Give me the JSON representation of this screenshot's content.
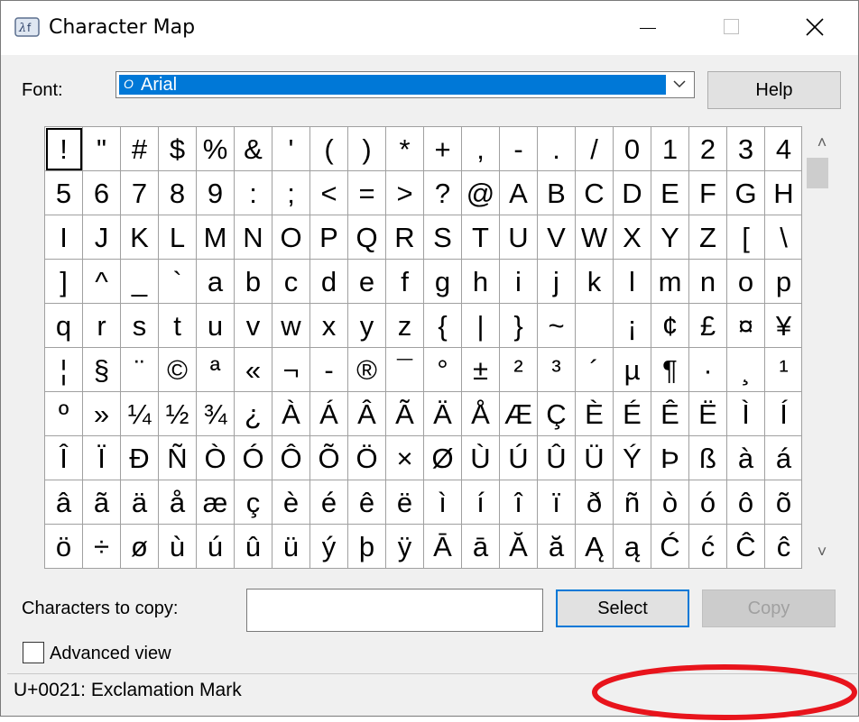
{
  "window": {
    "title": "Character Map",
    "app_icon": "charmap-icon"
  },
  "titlebar_buttons": {
    "minimize": "minimize-icon",
    "maximize": "maximize-icon",
    "close": "close-icon"
  },
  "font": {
    "label": "Font:",
    "value": "Arial",
    "glyph": "O"
  },
  "help_label": "Help",
  "characters": [
    "!",
    "\"",
    "#",
    "$",
    "%",
    "&",
    "'",
    "(",
    ")",
    "*",
    "+",
    ",",
    "-",
    ".",
    "/",
    "0",
    "1",
    "2",
    "3",
    "4",
    "5",
    "6",
    "7",
    "8",
    "9",
    ":",
    ";",
    "<",
    "=",
    ">",
    "?",
    "@",
    "A",
    "B",
    "C",
    "D",
    "E",
    "F",
    "G",
    "H",
    "I",
    "J",
    "K",
    "L",
    "M",
    "N",
    "O",
    "P",
    "Q",
    "R",
    "S",
    "T",
    "U",
    "V",
    "W",
    "X",
    "Y",
    "Z",
    "[",
    "\\",
    "]",
    "^",
    "_",
    "`",
    "a",
    "b",
    "c",
    "d",
    "e",
    "f",
    "g",
    "h",
    "i",
    "j",
    "k",
    "l",
    "m",
    "n",
    "o",
    "p",
    "q",
    "r",
    "s",
    "t",
    "u",
    "v",
    "w",
    "x",
    "y",
    "z",
    "{",
    "|",
    "}",
    "~",
    " ",
    "¡",
    "¢",
    "£",
    "¤",
    "¥",
    "¦",
    "§",
    "¨",
    "©",
    "ª",
    "«",
    "¬",
    "-",
    "®",
    "¯",
    "°",
    "±",
    "²",
    "³",
    "´",
    "µ",
    "¶",
    "·",
    "¸",
    "¹",
    "º",
    "»",
    "¼",
    "½",
    "¾",
    "¿",
    "À",
    "Á",
    "Â",
    "Ã",
    "Ä",
    "Å",
    "Æ",
    "Ç",
    "È",
    "É",
    "Ê",
    "Ë",
    "Ì",
    "Í",
    "Î",
    "Ï",
    "Ð",
    "Ñ",
    "Ò",
    "Ó",
    "Ô",
    "Õ",
    "Ö",
    "×",
    "Ø",
    "Ù",
    "Ú",
    "Û",
    "Ü",
    "Ý",
    "Þ",
    "ß",
    "à",
    "á",
    "â",
    "ã",
    "ä",
    "å",
    "æ",
    "ç",
    "è",
    "é",
    "ê",
    "ë",
    "ì",
    "í",
    "î",
    "ï",
    "ð",
    "ñ",
    "ò",
    "ó",
    "ô",
    "õ",
    "ö",
    "÷",
    "ø",
    "ù",
    "ú",
    "û",
    "ü",
    "ý",
    "þ",
    "ÿ",
    "Ā",
    "ā",
    "Ă",
    "ă",
    "Ą",
    "ą",
    "Ć",
    "ć",
    "Ĉ",
    "ĉ"
  ],
  "selected_index": 0,
  "scroll": {
    "up": "˄",
    "down": "˅"
  },
  "copy": {
    "label": "Characters to copy:",
    "value": ""
  },
  "select_label": "Select",
  "copy_label": "Copy",
  "advanced_view": {
    "label": "Advanced view",
    "checked": false
  },
  "status": {
    "text": "U+0021: Exclamation Mark"
  },
  "colors": {
    "accent": "#0078d7",
    "annotation": "#e8141c"
  }
}
